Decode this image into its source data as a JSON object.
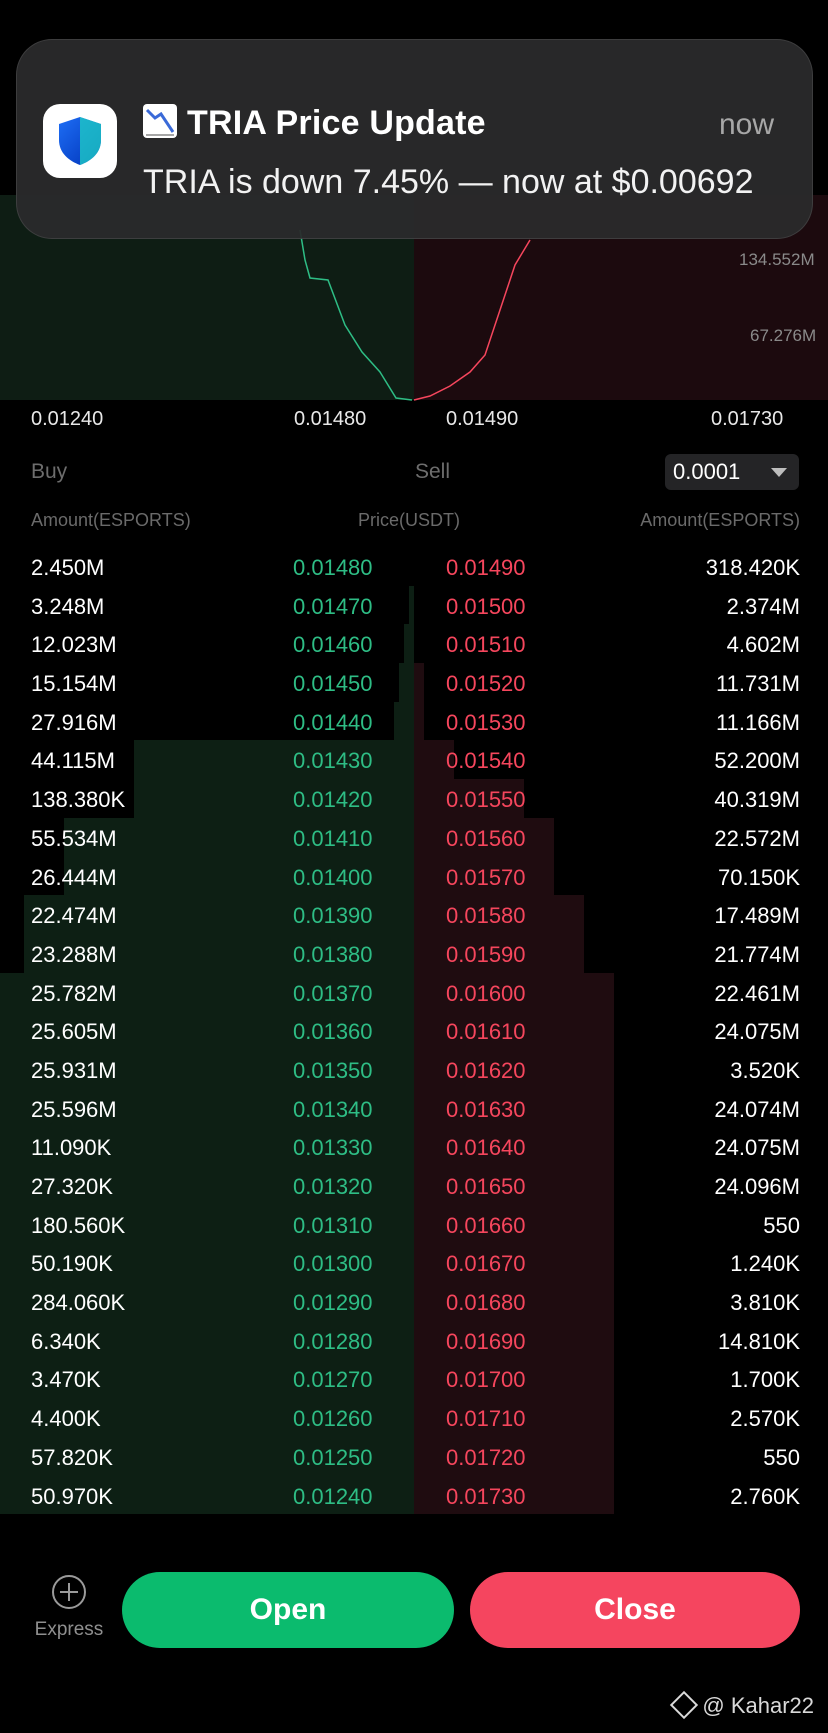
{
  "notification": {
    "emoji": "chart-decreasing-icon",
    "title": "TRIA Price Update",
    "time": "now",
    "body": "TRIA is down 7.45% — now at $0.00692"
  },
  "depth_chart": {
    "y_labels": [
      "134.552M",
      "67.276M"
    ],
    "price_axis": [
      "0.01240",
      "0.01480",
      "0.01490",
      "0.01730"
    ]
  },
  "orderbook": {
    "buy_label": "Buy",
    "sell_label": "Sell",
    "tick_size": "0.0001",
    "col_amount_left": "Amount(ESPORTS)",
    "col_price": "Price(USDT)",
    "col_amount_right": "Amount(ESPORTS)",
    "buy_color": "#2ebd85",
    "sell_color": "#f6465d",
    "rows": [
      {
        "bid_amount": "2.450M",
        "bid_price": "0.01480",
        "ask_price": "0.01490",
        "ask_amount": "318.420K"
      },
      {
        "bid_amount": "3.248M",
        "bid_price": "0.01470",
        "ask_price": "0.01500",
        "ask_amount": "2.374M"
      },
      {
        "bid_amount": "12.023M",
        "bid_price": "0.01460",
        "ask_price": "0.01510",
        "ask_amount": "4.602M"
      },
      {
        "bid_amount": "15.154M",
        "bid_price": "0.01450",
        "ask_price": "0.01520",
        "ask_amount": "11.731M"
      },
      {
        "bid_amount": "27.916M",
        "bid_price": "0.01440",
        "ask_price": "0.01530",
        "ask_amount": "11.166M"
      },
      {
        "bid_amount": "44.115M",
        "bid_price": "0.01430",
        "ask_price": "0.01540",
        "ask_amount": "52.200M"
      },
      {
        "bid_amount": "138.380K",
        "bid_price": "0.01420",
        "ask_price": "0.01550",
        "ask_amount": "40.319M"
      },
      {
        "bid_amount": "55.534M",
        "bid_price": "0.01410",
        "ask_price": "0.01560",
        "ask_amount": "22.572M"
      },
      {
        "bid_amount": "26.444M",
        "bid_price": "0.01400",
        "ask_price": "0.01570",
        "ask_amount": "70.150K"
      },
      {
        "bid_amount": "22.474M",
        "bid_price": "0.01390",
        "ask_price": "0.01580",
        "ask_amount": "17.489M"
      },
      {
        "bid_amount": "23.288M",
        "bid_price": "0.01380",
        "ask_price": "0.01590",
        "ask_amount": "21.774M"
      },
      {
        "bid_amount": "25.782M",
        "bid_price": "0.01370",
        "ask_price": "0.01600",
        "ask_amount": "22.461M"
      },
      {
        "bid_amount": "25.605M",
        "bid_price": "0.01360",
        "ask_price": "0.01610",
        "ask_amount": "24.075M"
      },
      {
        "bid_amount": "25.931M",
        "bid_price": "0.01350",
        "ask_price": "0.01620",
        "ask_amount": "3.520K"
      },
      {
        "bid_amount": "25.596M",
        "bid_price": "0.01340",
        "ask_price": "0.01630",
        "ask_amount": "24.074M"
      },
      {
        "bid_amount": "11.090K",
        "bid_price": "0.01330",
        "ask_price": "0.01640",
        "ask_amount": "24.075M"
      },
      {
        "bid_amount": "27.320K",
        "bid_price": "0.01320",
        "ask_price": "0.01650",
        "ask_amount": "24.096M"
      },
      {
        "bid_amount": "180.560K",
        "bid_price": "0.01310",
        "ask_price": "0.01660",
        "ask_amount": "550"
      },
      {
        "bid_amount": "50.190K",
        "bid_price": "0.01300",
        "ask_price": "0.01670",
        "ask_amount": "1.240K"
      },
      {
        "bid_amount": "284.060K",
        "bid_price": "0.01290",
        "ask_price": "0.01680",
        "ask_amount": "3.810K"
      },
      {
        "bid_amount": "6.340K",
        "bid_price": "0.01280",
        "ask_price": "0.01690",
        "ask_amount": "14.810K"
      },
      {
        "bid_amount": "3.470K",
        "bid_price": "0.01270",
        "ask_price": "0.01700",
        "ask_amount": "1.700K"
      },
      {
        "bid_amount": "4.400K",
        "bid_price": "0.01260",
        "ask_price": "0.01710",
        "ask_amount": "2.570K"
      },
      {
        "bid_amount": "57.820K",
        "bid_price": "0.01250",
        "ask_price": "0.01720",
        "ask_amount": "550"
      },
      {
        "bid_amount": "50.970K",
        "bid_price": "0.01240",
        "ask_price": "0.01730",
        "ask_amount": "2.760K"
      }
    ]
  },
  "bottom": {
    "express_label": "Express",
    "open_label": "Open",
    "close_label": "Close",
    "open_color": "#0bbb6e",
    "close_color": "#f5455f"
  },
  "watermark": "@ Kahar22"
}
